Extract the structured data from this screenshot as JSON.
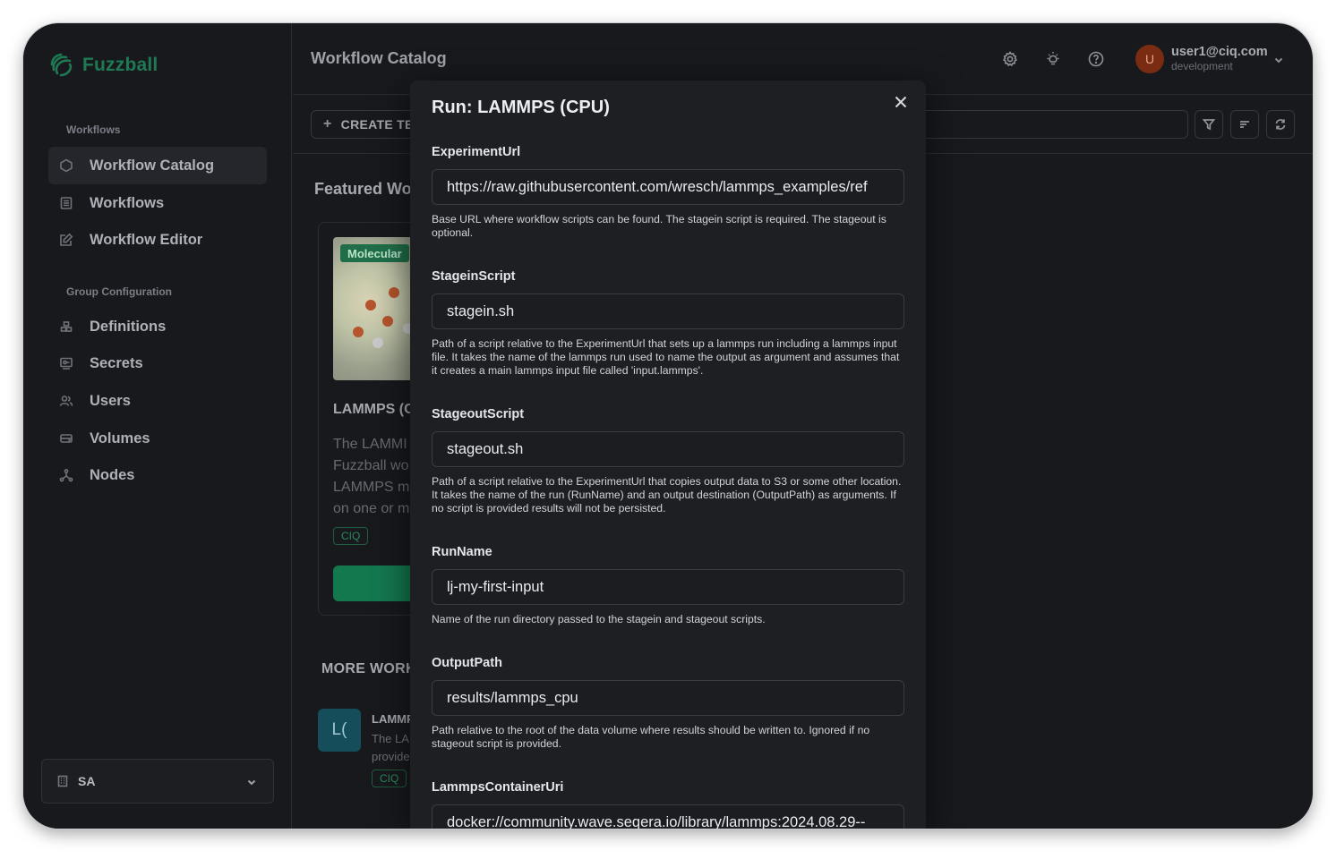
{
  "app": {
    "brand": "Fuzzball",
    "brand_color": "#1f7a54"
  },
  "sidebar": {
    "workflows_label": "Workflows",
    "workflow_items": [
      {
        "label": "Workflow Catalog",
        "icon": "hexagon-icon",
        "active": true
      },
      {
        "label": "Workflows",
        "icon": "list-icon"
      },
      {
        "label": "Workflow Editor",
        "icon": "edit-icon"
      }
    ],
    "group_label": "Group Configuration",
    "group_items": [
      {
        "label": "Definitions",
        "icon": "stack-icon"
      },
      {
        "label": "Secrets",
        "icon": "key-icon"
      },
      {
        "label": "Users",
        "icon": "users-icon"
      },
      {
        "label": "Volumes",
        "icon": "drive-icon"
      },
      {
        "label": "Nodes",
        "icon": "network-icon"
      }
    ],
    "group_select": {
      "value": "SA",
      "icon": "building-icon"
    }
  },
  "header": {
    "title": "Workflow Catalog",
    "icons": [
      "gear-icon",
      "lightbulb-icon",
      "help-icon"
    ],
    "user": {
      "initial": "U",
      "email": "user1@ciq.com",
      "env": "development",
      "avatar_color": "#7a2c12"
    }
  },
  "toolbar": {
    "create_label": "CREATE TE",
    "buttons": [
      "filter-icon",
      "sort-icon",
      "refresh-icon"
    ]
  },
  "featured": {
    "title": "Featured Wo",
    "card": {
      "tag": "Molecular",
      "title": "LAMMPS (C",
      "desc_lines": [
        "The LAMMI",
        "Fuzzball wo",
        "LAMMPS m",
        "on one or m"
      ],
      "badge": "CIQ"
    }
  },
  "more": {
    "title": "MORE WORK",
    "item": {
      "icon_text": "L(",
      "title": "LAMMP",
      "desc_lines": [
        "The LAI",
        "provide"
      ],
      "badge": "CIQ"
    }
  },
  "modal": {
    "title": "Run: LAMMPS (CPU)",
    "fields": [
      {
        "label": "ExperimentUrl",
        "value": "https://raw.githubusercontent.com/wresch/lammps_examples/ref",
        "help": "Base URL where workflow scripts can be found. The stagein script is required. The stageout is optional."
      },
      {
        "label": "StageinScript",
        "value": "stagein.sh",
        "help": "Path of a script relative to the ExperimentUrl that sets up a lammps run including a lammps input file. It takes the name of the lammps run used to name the output as argument and assumes that it creates a main lammps input file called 'input.lammps'."
      },
      {
        "label": "StageoutScript",
        "value": "stageout.sh",
        "help": "Path of a script relative to the ExperimentUrl that copies output data to S3 or some other location. It takes the name of the run (RunName) and an output destination (OutputPath) as arguments. If no script is provided results will not be persisted."
      },
      {
        "label": "RunName",
        "value": "lj-my-first-input",
        "help": "Name of the run directory passed to the stagein and stageout scripts."
      },
      {
        "label": "OutputPath",
        "value": "results/lammps_cpu",
        "help": "Path relative to the root of the data volume where results should be written to. Ignored if no stageout script is provided."
      },
      {
        "label": "LammpsContainerUri",
        "value": "docker://community.wave.seqera.io/library/lammps:2024.08.29--",
        "help": ""
      }
    ]
  }
}
